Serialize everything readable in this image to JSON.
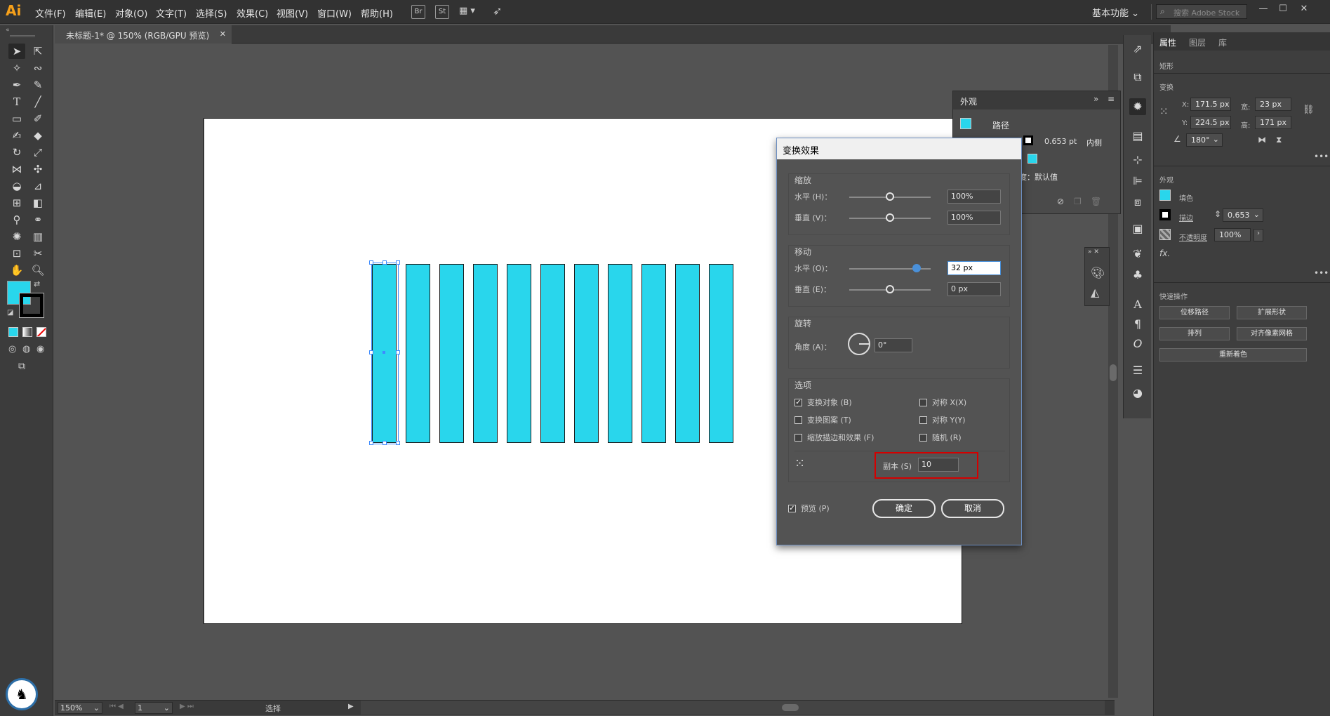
{
  "app": {
    "logo": "Ai",
    "workspace": "基本功能",
    "search_placeholder": "搜索 Adobe Stock"
  },
  "menu": [
    "文件(F)",
    "编辑(E)",
    "对象(O)",
    "文字(T)",
    "选择(S)",
    "效果(C)",
    "视图(V)",
    "窗口(W)",
    "帮助(H)"
  ],
  "menubar_icons": [
    "Br",
    "St"
  ],
  "document": {
    "tab_title": "未标题-1* @ 150% (RGB/GPU 预览)"
  },
  "colors": {
    "fill": "#29d6ec",
    "accent": "#4a90d9",
    "highlight_box": "#d40000"
  },
  "artwork": {
    "bar_count": 11
  },
  "status": {
    "zoom": "150%",
    "artboard": "1",
    "tool": "选择"
  },
  "appearance": {
    "title": "外观",
    "object": "路径",
    "stroke_weight": "0.653 pt",
    "stroke_align": "内侧",
    "opacity_label": "度：默认值"
  },
  "props": {
    "tabs": [
      "属性",
      "图层",
      "库"
    ],
    "object_type": "矩形",
    "transform_label": "变换",
    "x_label": "X:",
    "x": "171.5 px",
    "w_label": "宽:",
    "w": "23 px",
    "y_label": "Y:",
    "y": "224.5 px",
    "h_label": "高:",
    "h": "171 px",
    "angle": "180°",
    "appearance_label": "外观",
    "fill_label": "填色",
    "stroke_label": "描边",
    "stroke_value": "0.653",
    "opacity_label": "不透明度",
    "opacity": "100%",
    "fx": "fx.",
    "quick_label": "快速操作",
    "btn_offset": "位移路径",
    "btn_expand": "扩展形状",
    "btn_arrange": "排列",
    "btn_align_pixel": "对齐像素网格",
    "btn_recolor": "重新着色"
  },
  "dialog": {
    "title": "变换效果",
    "scale": {
      "label": "缩放",
      "h_label": "水平 (H)：",
      "h_value": "100%",
      "h_slider": 0.5,
      "v_label": "垂直 (V)：",
      "v_value": "100%",
      "v_slider": 0.5
    },
    "move": {
      "label": "移动",
      "h_label": "水平 (O)：",
      "h_value": "32 px",
      "h_slider": 0.83,
      "v_label": "垂直 (E)：",
      "v_value": "0 px",
      "v_slider": 0.5
    },
    "rotate": {
      "label": "旋转",
      "angle_label": "角度 (A)：",
      "angle_value": "0°"
    },
    "options": {
      "label": "选项",
      "transform_objects": "变换对象 (B)",
      "transform_objects_checked": true,
      "transform_patterns": "变换图案 (T)",
      "transform_patterns_checked": false,
      "scale_strokes": "缩放描边和效果 (F)",
      "scale_strokes_checked": false,
      "reflect_x": "对称 X(X)",
      "reflect_x_checked": false,
      "reflect_y": "对称 Y(Y)",
      "reflect_y_checked": false,
      "random": "随机 (R)",
      "random_checked": false
    },
    "copies_label": "副本 (S)",
    "copies_value": "10",
    "preview_label": "预览 (P)",
    "preview_checked": true,
    "ok": "确定",
    "cancel": "取消"
  }
}
